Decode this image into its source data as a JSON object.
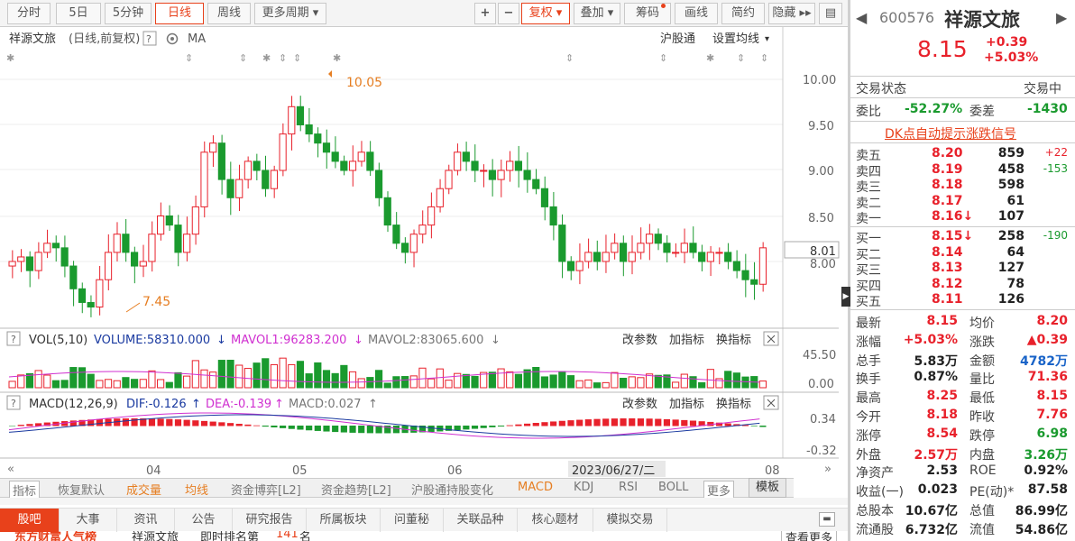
{
  "toolbar": {
    "items": [
      "分时",
      "5日",
      "5分钟",
      "日线",
      "周线",
      "更多周期",
      "+",
      "−",
      "复权",
      "叠加",
      "筹码",
      "画线",
      "简约",
      "隐藏"
    ],
    "active": "日线"
  },
  "chart": {
    "stock_label": "祥源文旅",
    "period_label": "(日线,前复权)",
    "help": "?",
    "ma_label": "MA",
    "hgt_link": "沪股通",
    "set_ma": "设置均线",
    "high_annot": "10.05",
    "low_annot": "7.45",
    "current_tag": "8.01",
    "price_ticks": [
      "10.00",
      "9.50",
      "9.00",
      "8.50",
      "8.00"
    ],
    "vol_label": "VOL(5,10)",
    "vol_value": "VOLUME:58310.000",
    "mavol1": "MAVOL1:96283.200",
    "mavol2": "MAVOL2:83065.600",
    "vol_ticks": [
      "45.50",
      "0.00"
    ],
    "macd_label": "MACD(12,26,9)",
    "dif": "DIF:-0.126",
    "dea": "DEA:-0.139",
    "macd_val": "MACD:0.027",
    "macd_ticks": [
      "0.34",
      "-0.32"
    ],
    "panel_btns": [
      "改参数",
      "加指标",
      "换指标"
    ],
    "x_ticks": [
      "04",
      "05",
      "06",
      "08"
    ],
    "cursor_date": "2023/06/27/二"
  },
  "subbar": [
    "指标",
    "恢复默认",
    "成交量",
    "均线",
    "资金博弈[L2]",
    "资金趋势[L2]",
    "沪股通持股变化",
    "MACD",
    "KDJ",
    "RSI",
    "BOLL",
    "更多"
  ],
  "model_tab": "模板",
  "tabs": [
    "股吧",
    "大事",
    "资讯",
    "公告",
    "研究报告",
    "所属板块",
    "问董秘",
    "关联品种",
    "核心题材",
    "模拟交易"
  ],
  "news": {
    "left": "东方财富人气榜",
    "stock": "祥源文旅",
    "text": "即时排名第",
    "rank": "141",
    "unit": "名",
    "more": "查看更多"
  },
  "colors": {
    "up": "#e8212b",
    "down": "#1a9a2e",
    "accent": "#e8411b",
    "ma5": "#d030d0",
    "ma10": "#1a3aa0"
  },
  "quote": {
    "code": "600576",
    "name": "祥源文旅",
    "price": "8.15",
    "change": "+0.39",
    "pct": "+5.03%",
    "state_label": "交易状态",
    "state": "交易中",
    "wb_label": "委比",
    "wb": "-52.27%",
    "wc_label": "委差",
    "wc": "-1430",
    "dk": "DK点自动提示涨跌信号",
    "asks": [
      {
        "label": "卖五",
        "price": "8.20",
        "vol": "859",
        "chg": "+22"
      },
      {
        "label": "卖四",
        "price": "8.19",
        "vol": "458",
        "chg": "-153"
      },
      {
        "label": "卖三",
        "price": "8.18",
        "vol": "598",
        "chg": ""
      },
      {
        "label": "卖二",
        "price": "8.17",
        "vol": "61",
        "chg": ""
      },
      {
        "label": "卖一",
        "price": "8.16↓",
        "vol": "107",
        "chg": ""
      }
    ],
    "bids": [
      {
        "label": "买一",
        "price": "8.15↓",
        "vol": "258",
        "chg": "-190"
      },
      {
        "label": "买二",
        "price": "8.14",
        "vol": "64",
        "chg": ""
      },
      {
        "label": "买三",
        "price": "8.13",
        "vol": "127",
        "chg": ""
      },
      {
        "label": "买四",
        "price": "8.12",
        "vol": "78",
        "chg": ""
      },
      {
        "label": "买五",
        "price": "8.11",
        "vol": "126",
        "chg": ""
      }
    ],
    "stats": [
      [
        "最新",
        "8.15",
        "均价",
        "8.20"
      ],
      [
        "涨幅",
        "+5.03%",
        "涨跌",
        "▲0.39"
      ],
      [
        "总手",
        "5.83万",
        "金额",
        "4782万"
      ],
      [
        "换手",
        "0.87%",
        "量比",
        "71.36"
      ],
      [
        "最高",
        "8.25",
        "最低",
        "8.15"
      ],
      [
        "今开",
        "8.18",
        "昨收",
        "7.76"
      ],
      [
        "涨停",
        "8.54",
        "跌停",
        "6.98"
      ],
      [
        "外盘",
        "2.57万",
        "内盘",
        "3.26万"
      ],
      [
        "净资产",
        "2.53",
        "ROE",
        "0.92%"
      ],
      [
        "收益(一)",
        "0.023",
        "PE(动)*",
        "87.58"
      ],
      [
        "总股本",
        "10.67亿",
        "总值",
        "86.99亿"
      ],
      [
        "流通股",
        "6.732亿",
        "流值",
        "54.86亿"
      ]
    ]
  }
}
